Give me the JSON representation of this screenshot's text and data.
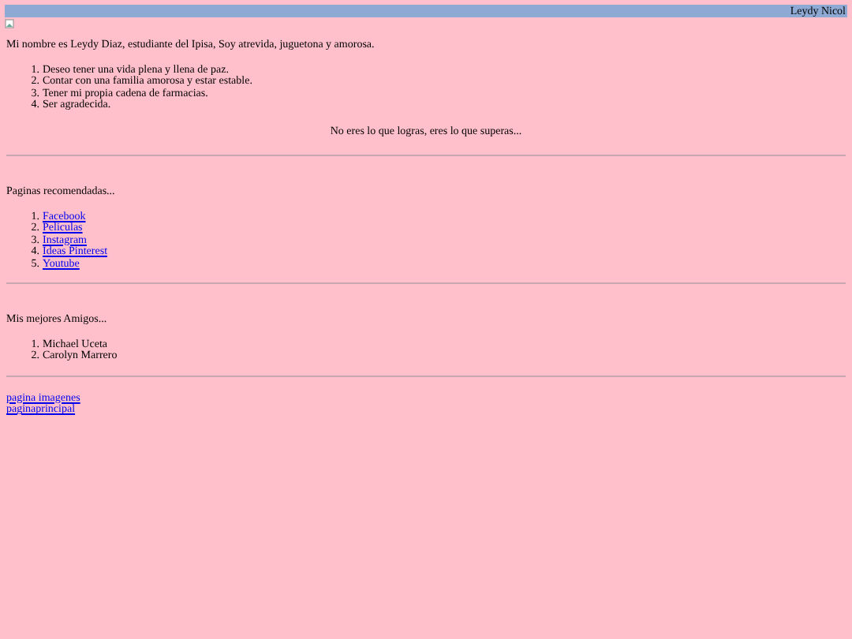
{
  "header": {
    "name": "Leydy Nicol"
  },
  "intro": "Mi nombre es Leydy Diaz, estudiante del Ipisa, Soy atrevida, juguetona y amorosa.",
  "goals": [
    {
      "number": "1.",
      "text": "Deseo tener una vida plena y llena de paz."
    },
    {
      "number": "2.",
      "text": "Contar con una familia amorosa y estar estable."
    },
    {
      "number": "3.",
      "text": "Tener mi propia cadena de farmacias."
    },
    {
      "number": "4.",
      "text": "Ser agradecida."
    }
  ],
  "quote": "No eres lo que logras, eres lo que superas...",
  "recommended": {
    "title": "Paginas recomendadas...",
    "links": [
      {
        "number": "1.",
        "text": "Facebook"
      },
      {
        "number": "2.",
        "text": "Peliculas"
      },
      {
        "number": "3.",
        "text": "Instagram"
      },
      {
        "number": "4.",
        "text": "Ideas Pinterest"
      },
      {
        "number": "5.",
        "text": "Youtube"
      }
    ]
  },
  "friends": {
    "title": "Mis mejores Amigos...",
    "items": [
      {
        "number": "1.",
        "text": "Michael Uceta"
      },
      {
        "number": "2.",
        "text": "Carolyn Marrero"
      }
    ]
  },
  "footer_links": [
    "pagina imagenes",
    "paginaprincipal"
  ]
}
